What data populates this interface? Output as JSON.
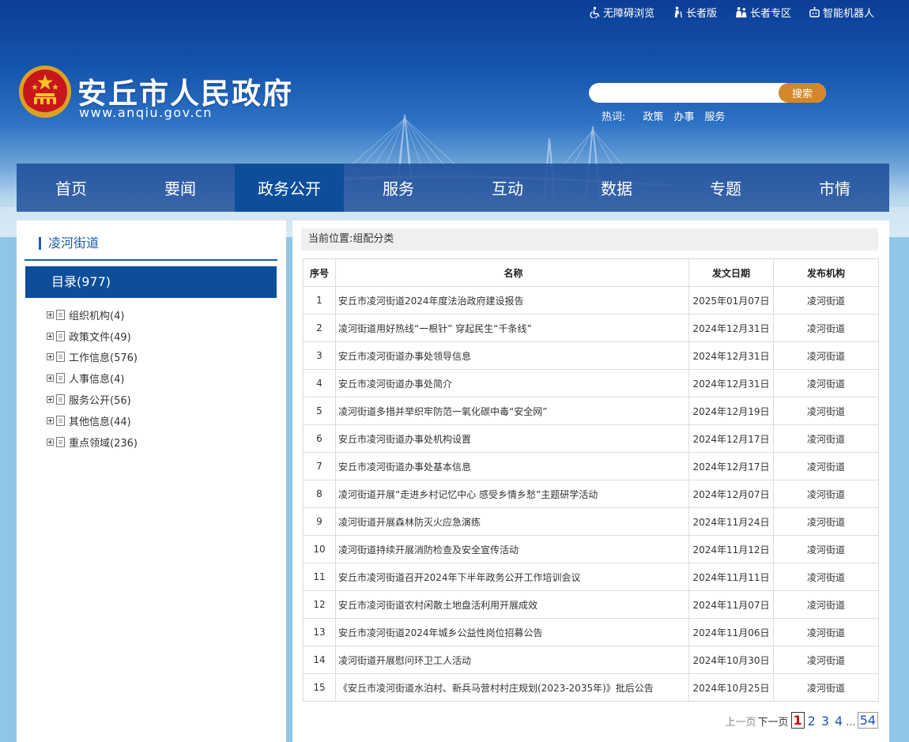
{
  "top_links": [
    {
      "label": "无障碍浏览",
      "icon": "wheelchair-icon"
    },
    {
      "label": "长者版",
      "icon": "elder-icon"
    },
    {
      "label": "长者专区",
      "icon": "elder-group-icon"
    },
    {
      "label": "智能机器人",
      "icon": "robot-icon"
    }
  ],
  "site": {
    "title": "安丘市人民政府",
    "url": "www.anqiu.gov.cn"
  },
  "search": {
    "placeholder": "",
    "button_label": "搜索"
  },
  "hot_words": {
    "label": "热词:",
    "words": [
      "政策",
      "办事",
      "服务"
    ]
  },
  "nav": {
    "items": [
      "首页",
      "要闻",
      "政务公开",
      "服务",
      "互动",
      "数据",
      "专题",
      "市情"
    ],
    "active_index": 2
  },
  "sidebar": {
    "title": "凌河街道",
    "catalog_label": "目录(977)",
    "tree": [
      {
        "label": "组织机构(4)"
      },
      {
        "label": "政策文件(49)"
      },
      {
        "label": "工作信息(576)"
      },
      {
        "label": "人事信息(4)"
      },
      {
        "label": "服务公开(56)"
      },
      {
        "label": "其他信息(44)"
      },
      {
        "label": "重点领域(236)"
      }
    ]
  },
  "breadcrumb": {
    "prefix": "当前位置:",
    "current": "组配分类"
  },
  "table": {
    "headers": {
      "no": "序号",
      "name": "名称",
      "date": "发文日期",
      "org": "发布机构"
    },
    "rows": [
      {
        "no": "1",
        "name": "安丘市凌河街道2024年度法治政府建设报告",
        "date": "2025年01月07日",
        "org": "凌河街道"
      },
      {
        "no": "2",
        "name": "凌河街道用好热线“一根针” 穿起民生“千条线”",
        "date": "2024年12月31日",
        "org": "凌河街道"
      },
      {
        "no": "3",
        "name": "安丘市凌河街道办事处领导信息",
        "date": "2024年12月31日",
        "org": "凌河街道"
      },
      {
        "no": "4",
        "name": "安丘市凌河街道办事处简介",
        "date": "2024年12月31日",
        "org": "凌河街道"
      },
      {
        "no": "5",
        "name": "凌河街道多措并举织牢防范一氧化碳中毒“安全网”",
        "date": "2024年12月19日",
        "org": "凌河街道"
      },
      {
        "no": "6",
        "name": "安丘市凌河街道办事处机构设置",
        "date": "2024年12月17日",
        "org": "凌河街道"
      },
      {
        "no": "7",
        "name": "安丘市凌河街道办事处基本信息",
        "date": "2024年12月17日",
        "org": "凌河街道"
      },
      {
        "no": "8",
        "name": "凌河街道开展“走进乡村记忆中心 感受乡情乡愁”主题研学活动",
        "date": "2024年12月07日",
        "org": "凌河街道"
      },
      {
        "no": "9",
        "name": "凌河街道开展森林防灭火应急演练",
        "date": "2024年11月24日",
        "org": "凌河街道"
      },
      {
        "no": "10",
        "name": "凌河街道持续开展消防检查及安全宣传活动",
        "date": "2024年11月12日",
        "org": "凌河街道"
      },
      {
        "no": "11",
        "name": "安丘市凌河街道召开2024年下半年政务公开工作培训会议",
        "date": "2024年11月11日",
        "org": "凌河街道"
      },
      {
        "no": "12",
        "name": "安丘市凌河街道农村闲散土地盘活利用开展成效",
        "date": "2024年11月07日",
        "org": "凌河街道"
      },
      {
        "no": "13",
        "name": "安丘市凌河街道2024年城乡公益性岗位招募公告",
        "date": "2024年11月06日",
        "org": "凌河街道"
      },
      {
        "no": "14",
        "name": "凌河街道开展慰问环卫工人活动",
        "date": "2024年10月30日",
        "org": "凌河街道"
      },
      {
        "no": "15",
        "name": "《安丘市凌河街道水泊村、新兵马营村村庄规划(2023-2035年)》批后公告",
        "date": "2024年10月25日",
        "org": "凌河街道"
      }
    ]
  },
  "pager": {
    "prev": "上一页",
    "next": "下一页",
    "current": "1",
    "pages": [
      "2",
      "3",
      "4"
    ],
    "ellipsis": "...",
    "last": "54"
  },
  "colors": {
    "nav_active": "#0d4e9b",
    "search_button": "#d4872a",
    "accent_blue": "#1b5ea8"
  }
}
